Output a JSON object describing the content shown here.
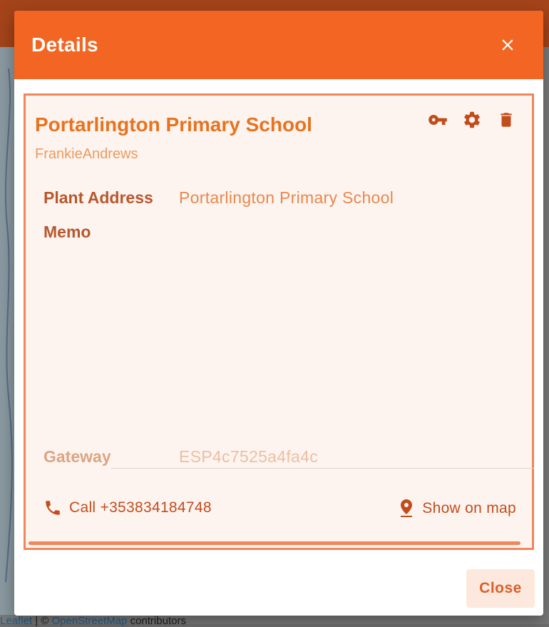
{
  "dialog": {
    "title": "Details",
    "close_button_label": "Close"
  },
  "plant": {
    "name": "Portarlington Primary School",
    "owner": "FrankieAndrews",
    "fields": {
      "address_label": "Plant Address",
      "address_value": "Portarlington Primary School",
      "memo_label": "Memo",
      "memo_value": "",
      "gateway_label": "Gateway",
      "gateway_value": "ESP4c7525a4fa4c"
    },
    "actions": {
      "call_label": "Call +353834184748",
      "show_map_label": "Show on map"
    },
    "icons": [
      "key-icon",
      "gear-icon",
      "trash-icon"
    ]
  },
  "background": {
    "attribution_leaflet": "Leaflet",
    "attribution_separator": " | © ",
    "attribution_osm": "OpenStreetMap",
    "attribution_suffix": " contributors"
  },
  "colors": {
    "header": "#f26522",
    "accent": "#e8731f",
    "card_border": "#f0865a",
    "card_bg": "#fdf4f0"
  }
}
